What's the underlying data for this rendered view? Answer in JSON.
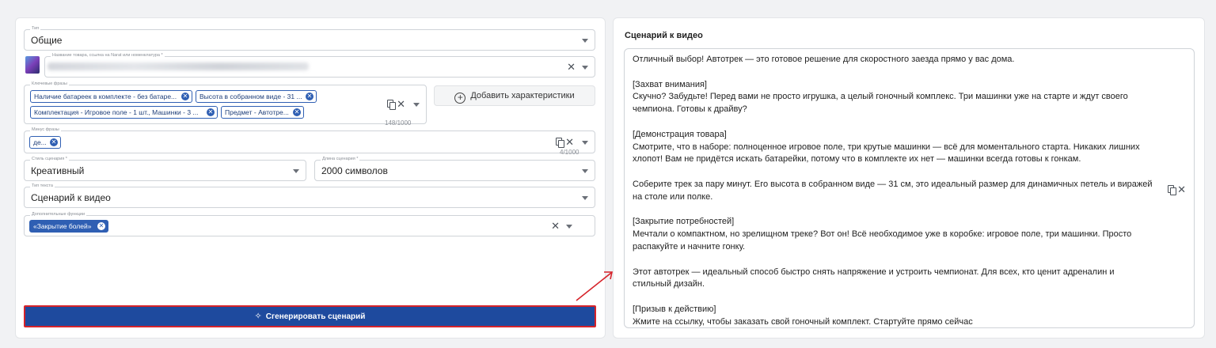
{
  "left": {
    "type_field": {
      "label": "Тип",
      "value": "Общие"
    },
    "product_field": {
      "label": "Название товара, ссылка на Narat или номенклатура *"
    },
    "keywords_field": {
      "label": "Ключевые фразы",
      "chips": [
        "Наличие батареек в комплекте - без батаре...",
        "Высота в собранном виде - 31 ...",
        "Комплектация - Игровое поле - 1 шт., Машинки - 3 ...",
        "Предмет - Автотре..."
      ],
      "counter": "148/1000"
    },
    "add_characteristics_button": "Добавить характеристики",
    "minus_field": {
      "label": "Минус фразы",
      "chips": [
        "де..."
      ],
      "counter": "4/1000"
    },
    "style_field": {
      "label": "Стиль сценария *",
      "value": "Креативный"
    },
    "length_field": {
      "label": "Длина сценария *",
      "value": "2000 символов"
    },
    "text_type_field": {
      "label": "Тип текста",
      "value": "Сценарий к видео"
    },
    "extra_field": {
      "label": "Дополнительные функции",
      "chips": [
        "«Закрытие болей»"
      ]
    },
    "generate_button": "Сгенерировать сценарий"
  },
  "right": {
    "title": "Сценарий к видео",
    "script": "Отличный выбор! Автотрек — это готовое решение для скоростного заезда прямо у вас дома.\n\n[Захват внимания]\nСкучно? Забудьте! Перед вами не просто игрушка, а целый гоночный комплекс. Три машинки уже на старте и ждут своего чемпиона. Готовы к драйву?\n\n[Демонстрация товара]\nСмотрите, что в наборе: полноценное игровое поле, три крутые машинки — всё для моментального старта. Никаких лишних хлопот! Вам не придётся искать батарейки, потому что в комплекте их нет — машинки всегда готовы к гонкам.\n\nСоберите трек за пару минут. Его высота в собранном виде — 31 см, это идеальный размер для динамичных петель и виражей на столе или полке.\n\n[Закрытие потребностей]\nМечтали о компактном, но зрелищном треке? Вот он! Всё необходимое уже в коробке: игровое поле, три машинки. Просто распакуйте и начните гонку.\n\nЭтот автотрек — идеальный способ быстро снять напряжение и устроить чемпионат. Для всех, кто ценит адреналин и стильный дизайн.\n\n[Призыв к действию]\nЖмите на ссылку, чтобы заказать свой гоночный комплект. Стартуйте прямо сейчас"
  },
  "colors": {
    "primary": "#1e4a9e",
    "highlight_border": "#d6232a",
    "annotation_arrow": "#d6232a"
  }
}
